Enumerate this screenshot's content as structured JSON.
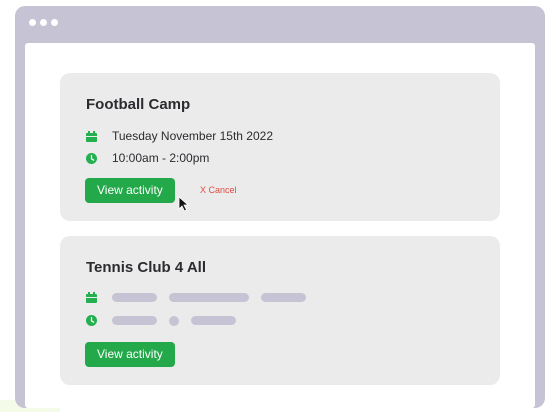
{
  "activities": [
    {
      "title": "Football Camp",
      "date": "Tuesday November 15th 2022",
      "time": "10:00am - 2:00pm",
      "view_label": "View activity",
      "cancel_label": "X Cancel"
    },
    {
      "title": "Tennis Club 4 All",
      "view_label": "View activity",
      "details_loading": true
    }
  ],
  "icons": {
    "date": "calendar-icon",
    "time": "clock-icon",
    "pointer": "mouse-cursor-icon"
  },
  "colors": {
    "accent": "#23a84a",
    "cancel": "#e34b44",
    "chrome": "#c6c3d4",
    "card": "#ebebeb"
  }
}
